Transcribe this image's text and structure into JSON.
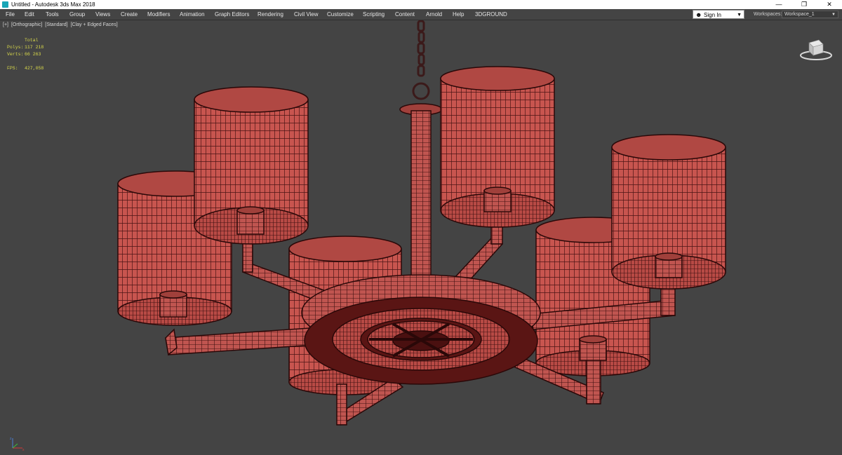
{
  "titlebar": {
    "title": "Untitled - Autodesk 3ds Max 2018",
    "minimize_glyph": "—",
    "restore_glyph": "❐",
    "close_glyph": "✕"
  },
  "menu": [
    "File",
    "Edit",
    "Tools",
    "Group",
    "Views",
    "Create",
    "Modifiers",
    "Animation",
    "Graph Editors",
    "Rendering",
    "Civil View",
    "Customize",
    "Scripting",
    "Content",
    "Arnold",
    "Help",
    "3DGROUND"
  ],
  "account": {
    "signin_label": "Sign In"
  },
  "workspaces": {
    "label": "Workspaces:",
    "value": "Workspace_1"
  },
  "viewport": {
    "label_parts": [
      "[+]",
      "[Orthographic]",
      "[Standard]",
      "[Clay + Edged Faces]"
    ],
    "stats": {
      "header": "Total",
      "polys_label": "Polys:",
      "polys_value": "117 218",
      "verts_label": "Verts:",
      "verts_value": "66 263",
      "fps_label": "FPS:",
      "fps_value": "427,058"
    }
  },
  "colors": {
    "background": "#444444",
    "shade_fill": "#c8554f",
    "wire": "#3a0f0f",
    "stats_text": "#d9d94a"
  },
  "icons": {
    "app": "3ds-max-app-icon",
    "viewcube": "viewcube-icon",
    "axis": "axis-tripod-icon",
    "user": "user-icon"
  }
}
